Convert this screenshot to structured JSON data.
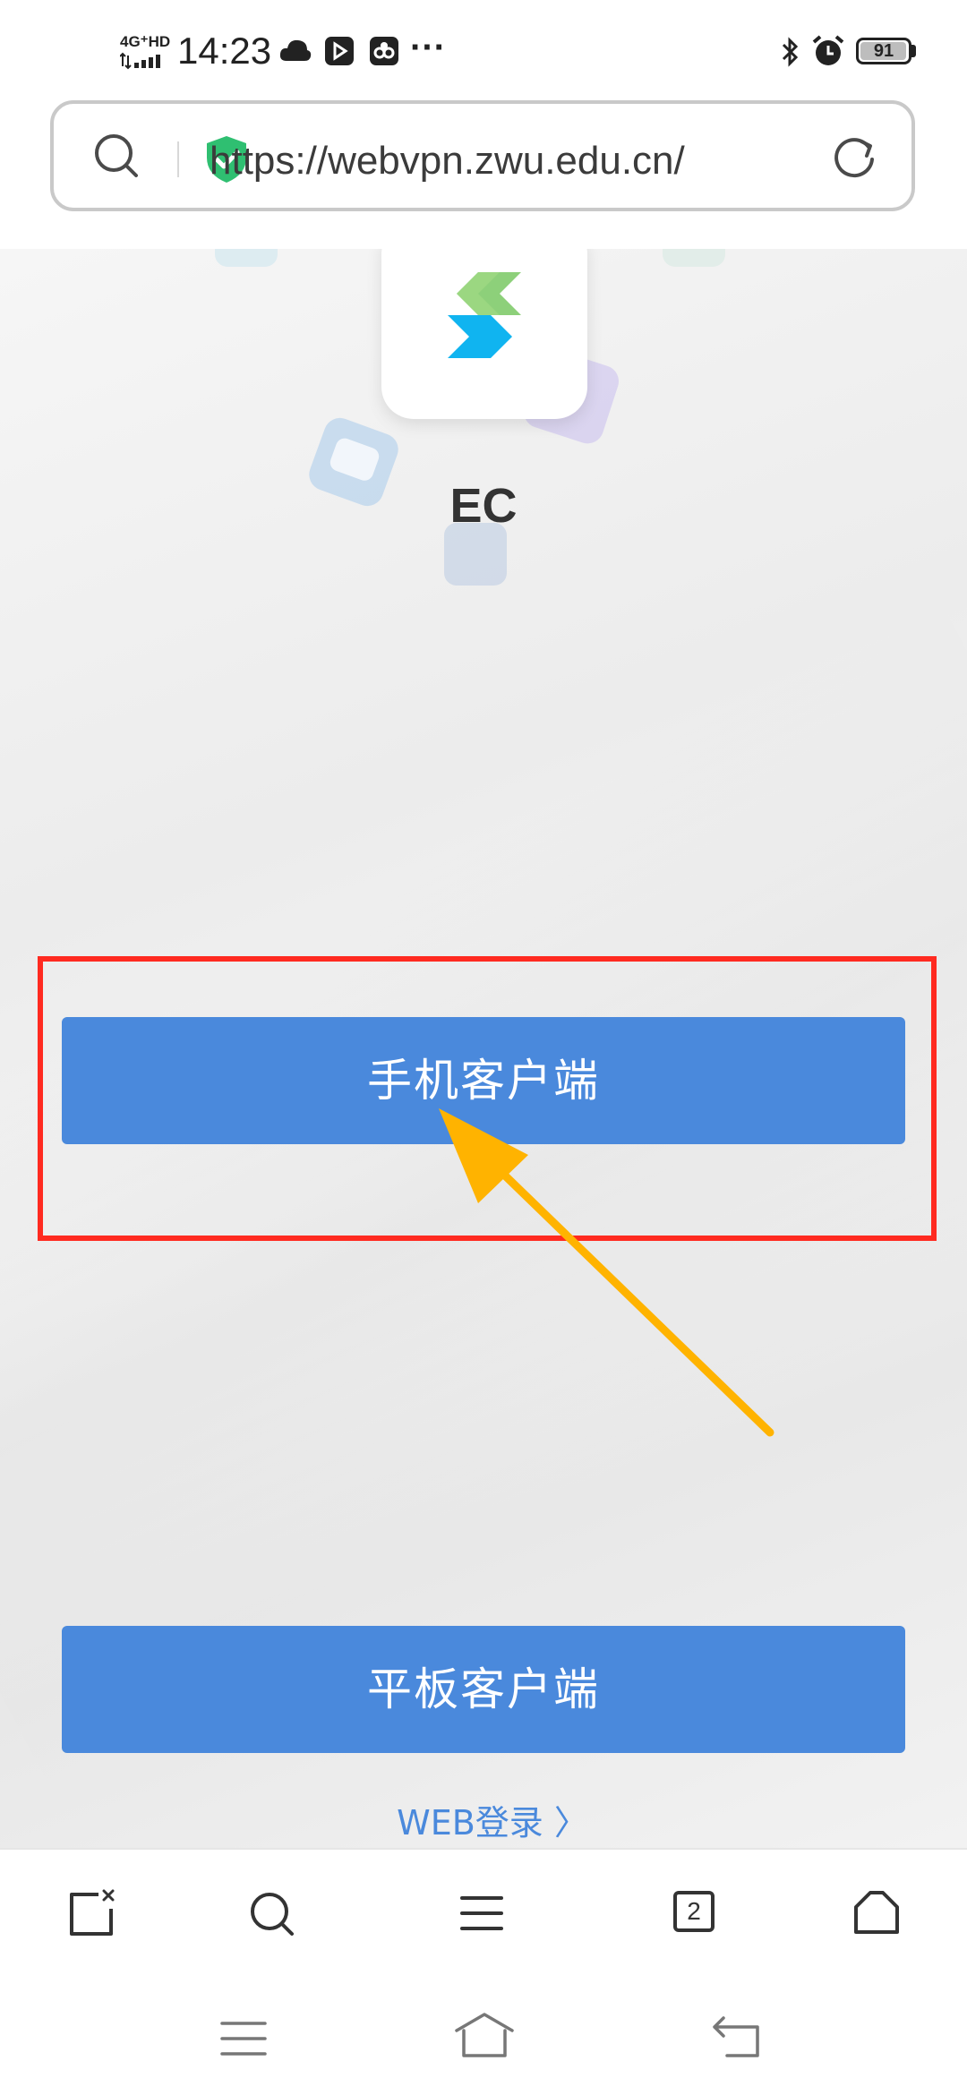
{
  "status_bar": {
    "time": "14:23",
    "network": "4G⁺HD",
    "battery": "91",
    "more": "···"
  },
  "browser": {
    "url": "https://webvpn.zwu.edu.cn/"
  },
  "page": {
    "app_name": "EC",
    "mobile_client_label": "手机客户端",
    "tablet_client_label": "平板客户端",
    "web_login_label": "WEB登录 〉"
  },
  "toolbar": {
    "tabs_count": "2"
  },
  "colors": {
    "button_blue": "#4a89dc",
    "highlight_red": "#ff2a20",
    "arrow_yellow": "#ffb300",
    "link_blue": "#4a89dc"
  }
}
